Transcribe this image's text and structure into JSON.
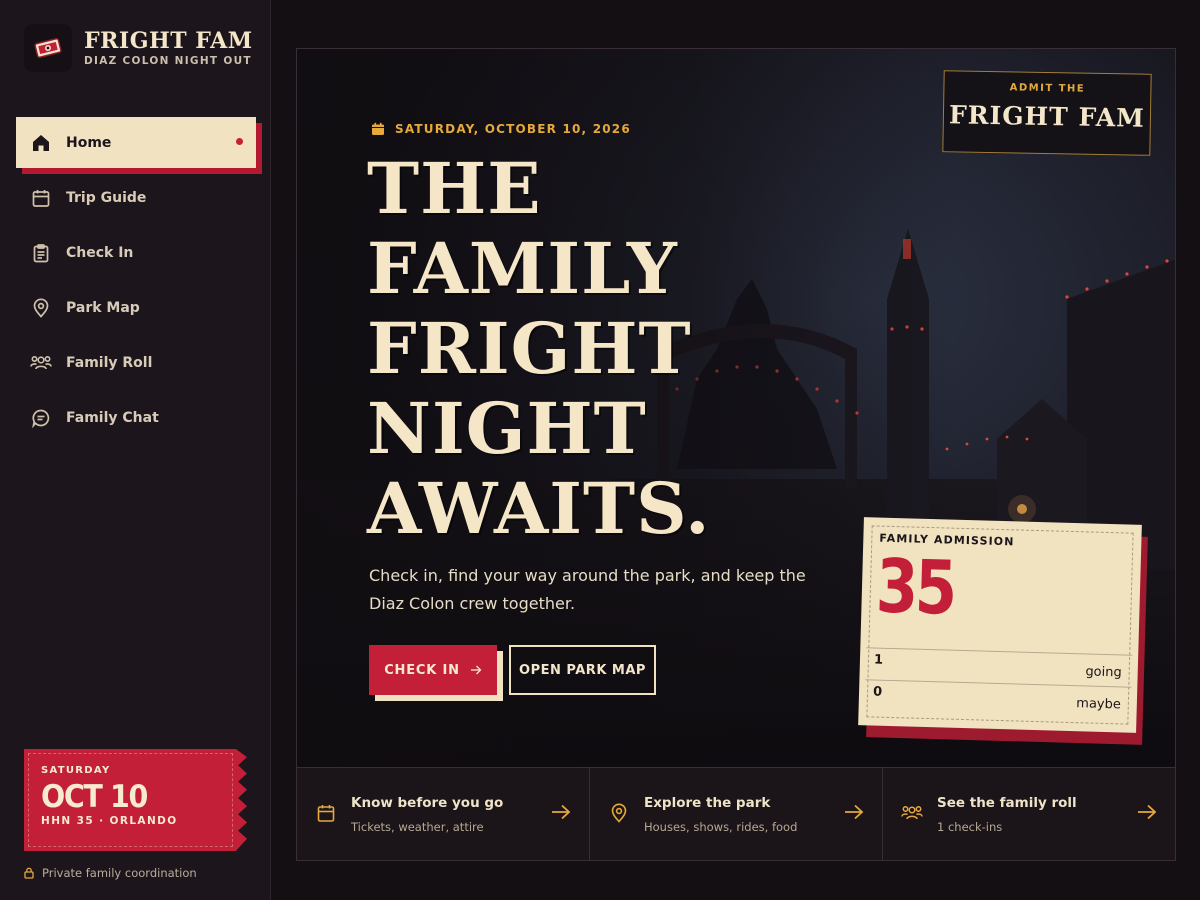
{
  "brand": {
    "title": "FRIGHT FAM",
    "subtitle": "DIAZ COLON NIGHT OUT",
    "logo_icon": "ticket-icon"
  },
  "nav": {
    "items": [
      {
        "label": "Home",
        "icon": "home-icon",
        "active": true
      },
      {
        "label": "Trip Guide",
        "icon": "calendar-icon",
        "active": false
      },
      {
        "label": "Check In",
        "icon": "clipboard-icon",
        "active": false
      },
      {
        "label": "Park Map",
        "icon": "map-pin-icon",
        "active": false
      },
      {
        "label": "Family Roll",
        "icon": "users-icon",
        "active": false
      },
      {
        "label": "Family Chat",
        "icon": "chat-icon",
        "active": false
      }
    ]
  },
  "ticket": {
    "day": "SATURDAY",
    "date": "OCT 10",
    "place": "HHN 35 · ORLANDO"
  },
  "privacy": {
    "text": "Private family coordination",
    "icon": "lock-icon"
  },
  "hero": {
    "admit_small": "ADMIT THE",
    "admit_big": "FRIGHT FAM",
    "date": "SATURDAY, OCTOBER 10, 2026",
    "headline": [
      "THE",
      "FAMILY",
      "FRIGHT",
      "NIGHT",
      "AWAITS."
    ],
    "subtext": "Check in, find your way around the park, and keep the Diaz Colon crew together.",
    "checkin_label": "CHECK IN",
    "map_label": "OPEN PARK MAP"
  },
  "admission": {
    "label": "FAMILY ADMISSION",
    "count": "35",
    "rows": [
      {
        "num": "1",
        "label": "going"
      },
      {
        "num": "0",
        "label": "maybe"
      }
    ]
  },
  "cards": [
    {
      "title": "Know before you go",
      "sub": "Tickets, weather, attire",
      "icon": "calendar-icon"
    },
    {
      "title": "Explore the park",
      "sub": "Houses, shows, rides, food",
      "icon": "map-pin-icon"
    },
    {
      "title": "See the family roll",
      "sub": "1 check-ins",
      "icon": "users-icon"
    }
  ],
  "colors": {
    "accent_red": "#c41f38",
    "cream": "#f1e3c2",
    "gold": "#e6a93a",
    "background": "#140f13"
  }
}
